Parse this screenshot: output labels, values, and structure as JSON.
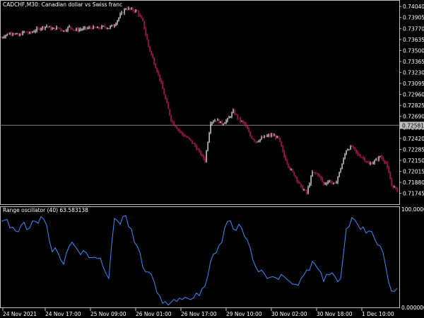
{
  "main_panel": {
    "title": "CADCHF,M30:  Canadian dollar vs Swiss franc",
    "price_axis_labels": [
      "0.74040",
      "0.73905",
      "0.73770",
      "0.73635",
      "0.73500",
      "0.73365",
      "0.73230",
      "0.73095",
      "0.72960",
      "0.72825",
      "0.72690",
      "0.72555",
      "0.72420",
      "0.72285",
      "0.72150",
      "0.72015",
      "0.71880",
      "0.71745"
    ],
    "price_range": [
      0.71655,
      0.74085
    ],
    "current_price_label": "0.72581",
    "current_price": 0.72581
  },
  "indicator_panel": {
    "title": "Range oscillator (40) 63.583138",
    "axis_labels": [
      "100.000000",
      "0.000000"
    ],
    "range": [
      0,
      100
    ]
  },
  "time_axis_labels": [
    "24 Nov 2021",
    "24 Nov 17:00",
    "25 Nov 09:00",
    "26 Nov 01:00",
    "26 Nov 17:00",
    "29 Nov 10:00",
    "30 Nov 02:00",
    "30 Nov 18:00",
    "1 Dec 10:00"
  ],
  "colors": {
    "background": "#000000",
    "frame": "#c0c0c0",
    "bull_candle": "#ffffff",
    "bear_candle": "#d4206a",
    "oscillator_line": "#3c8cff",
    "price_marker_bg": "#bdbdbd"
  },
  "chart_data": [
    {
      "type": "line",
      "name": "price_close",
      "x_index": [
        0,
        8,
        16,
        24,
        32,
        40,
        48,
        56,
        64,
        72,
        80,
        88,
        96,
        104,
        112,
        120,
        128,
        136,
        144,
        152,
        160,
        168,
        176,
        184,
        192,
        200,
        208,
        216,
        224,
        232,
        240,
        248,
        256,
        264,
        272,
        280,
        288,
        296,
        304,
        312,
        320,
        328,
        336,
        344,
        352,
        360,
        368,
        376,
        384,
        392,
        400,
        408,
        416,
        424,
        432,
        440,
        448,
        456,
        464,
        472,
        480,
        488,
        496,
        504,
        512,
        520,
        528,
        536,
        544,
        552,
        560
      ],
      "y": [
        0.7366,
        0.737,
        0.7372,
        0.7368,
        0.7373,
        0.7371,
        0.7375,
        0.7378,
        0.738,
        0.7376,
        0.7378,
        0.7374,
        0.7379,
        0.7375,
        0.7376,
        0.7377,
        0.7378,
        0.7377,
        0.7379,
        0.7378,
        0.7382,
        0.7393,
        0.7402,
        0.74,
        0.7398,
        0.7385,
        0.7355,
        0.7335,
        0.7315,
        0.729,
        0.7265,
        0.7255,
        0.7247,
        0.7242,
        0.7235,
        0.7225,
        0.7215,
        0.7262,
        0.7265,
        0.726,
        0.7265,
        0.7275,
        0.7265,
        0.726,
        0.7245,
        0.7238,
        0.7242,
        0.7245,
        0.7246,
        0.7242,
        0.722,
        0.7205,
        0.7195,
        0.7182,
        0.7175,
        0.72,
        0.7198,
        0.7186,
        0.719,
        0.7185,
        0.7205,
        0.7228,
        0.7232,
        0.7222,
        0.7218,
        0.721,
        0.7214,
        0.722,
        0.7212,
        0.7185,
        0.7178
      ]
    },
    {
      "type": "line",
      "name": "range_oscillator",
      "x_index": [
        0,
        8,
        16,
        24,
        32,
        40,
        48,
        56,
        64,
        72,
        80,
        88,
        96,
        104,
        112,
        120,
        128,
        136,
        144,
        152,
        160,
        168,
        176,
        184,
        192,
        200,
        208,
        216,
        224,
        232,
        240,
        248,
        256,
        264,
        272,
        280,
        288,
        296,
        304,
        312,
        320,
        328,
        336,
        344,
        352,
        360,
        368,
        376,
        384,
        392,
        400,
        408,
        416,
        424,
        432,
        440,
        448,
        456,
        464,
        472,
        480,
        488,
        496,
        504,
        512,
        520,
        528,
        536,
        544,
        552,
        560
      ],
      "y": [
        88,
        90,
        82,
        77,
        87,
        81,
        88,
        93,
        84,
        56,
        55,
        43,
        62,
        62,
        53,
        55,
        50,
        49,
        40,
        28,
        91,
        85,
        94,
        80,
        62,
        40,
        35,
        25,
        10,
        4,
        3,
        4,
        6,
        7,
        8,
        10,
        20,
        46,
        55,
        66,
        88,
        80,
        85,
        72,
        60,
        40,
        37,
        28,
        30,
        27,
        30,
        25,
        22,
        28,
        37,
        46,
        38,
        25,
        32,
        30,
        28,
        80,
        92,
        85,
        82,
        78,
        70,
        62,
        40,
        15,
        18
      ],
      "ylim": [
        0,
        100
      ]
    }
  ]
}
